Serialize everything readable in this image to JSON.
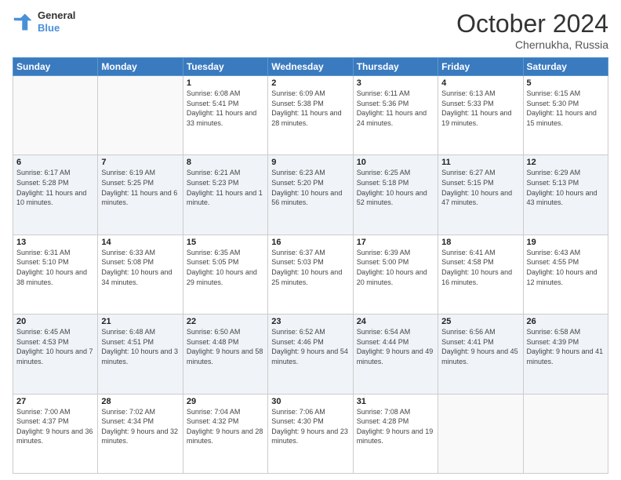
{
  "header": {
    "logo_line1": "General",
    "logo_line2": "Blue",
    "month": "October 2024",
    "location": "Chernukha, Russia"
  },
  "weekdays": [
    "Sunday",
    "Monday",
    "Tuesday",
    "Wednesday",
    "Thursday",
    "Friday",
    "Saturday"
  ],
  "weeks": [
    [
      {
        "day": "",
        "sunrise": "",
        "sunset": "",
        "daylight": ""
      },
      {
        "day": "",
        "sunrise": "",
        "sunset": "",
        "daylight": ""
      },
      {
        "day": "1",
        "sunrise": "Sunrise: 6:08 AM",
        "sunset": "Sunset: 5:41 PM",
        "daylight": "Daylight: 11 hours and 33 minutes."
      },
      {
        "day": "2",
        "sunrise": "Sunrise: 6:09 AM",
        "sunset": "Sunset: 5:38 PM",
        "daylight": "Daylight: 11 hours and 28 minutes."
      },
      {
        "day": "3",
        "sunrise": "Sunrise: 6:11 AM",
        "sunset": "Sunset: 5:36 PM",
        "daylight": "Daylight: 11 hours and 24 minutes."
      },
      {
        "day": "4",
        "sunrise": "Sunrise: 6:13 AM",
        "sunset": "Sunset: 5:33 PM",
        "daylight": "Daylight: 11 hours and 19 minutes."
      },
      {
        "day": "5",
        "sunrise": "Sunrise: 6:15 AM",
        "sunset": "Sunset: 5:30 PM",
        "daylight": "Daylight: 11 hours and 15 minutes."
      }
    ],
    [
      {
        "day": "6",
        "sunrise": "Sunrise: 6:17 AM",
        "sunset": "Sunset: 5:28 PM",
        "daylight": "Daylight: 11 hours and 10 minutes."
      },
      {
        "day": "7",
        "sunrise": "Sunrise: 6:19 AM",
        "sunset": "Sunset: 5:25 PM",
        "daylight": "Daylight: 11 hours and 6 minutes."
      },
      {
        "day": "8",
        "sunrise": "Sunrise: 6:21 AM",
        "sunset": "Sunset: 5:23 PM",
        "daylight": "Daylight: 11 hours and 1 minute."
      },
      {
        "day": "9",
        "sunrise": "Sunrise: 6:23 AM",
        "sunset": "Sunset: 5:20 PM",
        "daylight": "Daylight: 10 hours and 56 minutes."
      },
      {
        "day": "10",
        "sunrise": "Sunrise: 6:25 AM",
        "sunset": "Sunset: 5:18 PM",
        "daylight": "Daylight: 10 hours and 52 minutes."
      },
      {
        "day": "11",
        "sunrise": "Sunrise: 6:27 AM",
        "sunset": "Sunset: 5:15 PM",
        "daylight": "Daylight: 10 hours and 47 minutes."
      },
      {
        "day": "12",
        "sunrise": "Sunrise: 6:29 AM",
        "sunset": "Sunset: 5:13 PM",
        "daylight": "Daylight: 10 hours and 43 minutes."
      }
    ],
    [
      {
        "day": "13",
        "sunrise": "Sunrise: 6:31 AM",
        "sunset": "Sunset: 5:10 PM",
        "daylight": "Daylight: 10 hours and 38 minutes."
      },
      {
        "day": "14",
        "sunrise": "Sunrise: 6:33 AM",
        "sunset": "Sunset: 5:08 PM",
        "daylight": "Daylight: 10 hours and 34 minutes."
      },
      {
        "day": "15",
        "sunrise": "Sunrise: 6:35 AM",
        "sunset": "Sunset: 5:05 PM",
        "daylight": "Daylight: 10 hours and 29 minutes."
      },
      {
        "day": "16",
        "sunrise": "Sunrise: 6:37 AM",
        "sunset": "Sunset: 5:03 PM",
        "daylight": "Daylight: 10 hours and 25 minutes."
      },
      {
        "day": "17",
        "sunrise": "Sunrise: 6:39 AM",
        "sunset": "Sunset: 5:00 PM",
        "daylight": "Daylight: 10 hours and 20 minutes."
      },
      {
        "day": "18",
        "sunrise": "Sunrise: 6:41 AM",
        "sunset": "Sunset: 4:58 PM",
        "daylight": "Daylight: 10 hours and 16 minutes."
      },
      {
        "day": "19",
        "sunrise": "Sunrise: 6:43 AM",
        "sunset": "Sunset: 4:55 PM",
        "daylight": "Daylight: 10 hours and 12 minutes."
      }
    ],
    [
      {
        "day": "20",
        "sunrise": "Sunrise: 6:45 AM",
        "sunset": "Sunset: 4:53 PM",
        "daylight": "Daylight: 10 hours and 7 minutes."
      },
      {
        "day": "21",
        "sunrise": "Sunrise: 6:48 AM",
        "sunset": "Sunset: 4:51 PM",
        "daylight": "Daylight: 10 hours and 3 minutes."
      },
      {
        "day": "22",
        "sunrise": "Sunrise: 6:50 AM",
        "sunset": "Sunset: 4:48 PM",
        "daylight": "Daylight: 9 hours and 58 minutes."
      },
      {
        "day": "23",
        "sunrise": "Sunrise: 6:52 AM",
        "sunset": "Sunset: 4:46 PM",
        "daylight": "Daylight: 9 hours and 54 minutes."
      },
      {
        "day": "24",
        "sunrise": "Sunrise: 6:54 AM",
        "sunset": "Sunset: 4:44 PM",
        "daylight": "Daylight: 9 hours and 49 minutes."
      },
      {
        "day": "25",
        "sunrise": "Sunrise: 6:56 AM",
        "sunset": "Sunset: 4:41 PM",
        "daylight": "Daylight: 9 hours and 45 minutes."
      },
      {
        "day": "26",
        "sunrise": "Sunrise: 6:58 AM",
        "sunset": "Sunset: 4:39 PM",
        "daylight": "Daylight: 9 hours and 41 minutes."
      }
    ],
    [
      {
        "day": "27",
        "sunrise": "Sunrise: 7:00 AM",
        "sunset": "Sunset: 4:37 PM",
        "daylight": "Daylight: 9 hours and 36 minutes."
      },
      {
        "day": "28",
        "sunrise": "Sunrise: 7:02 AM",
        "sunset": "Sunset: 4:34 PM",
        "daylight": "Daylight: 9 hours and 32 minutes."
      },
      {
        "day": "29",
        "sunrise": "Sunrise: 7:04 AM",
        "sunset": "Sunset: 4:32 PM",
        "daylight": "Daylight: 9 hours and 28 minutes."
      },
      {
        "day": "30",
        "sunrise": "Sunrise: 7:06 AM",
        "sunset": "Sunset: 4:30 PM",
        "daylight": "Daylight: 9 hours and 23 minutes."
      },
      {
        "day": "31",
        "sunrise": "Sunrise: 7:08 AM",
        "sunset": "Sunset: 4:28 PM",
        "daylight": "Daylight: 9 hours and 19 minutes."
      },
      {
        "day": "",
        "sunrise": "",
        "sunset": "",
        "daylight": ""
      },
      {
        "day": "",
        "sunrise": "",
        "sunset": "",
        "daylight": ""
      }
    ]
  ]
}
